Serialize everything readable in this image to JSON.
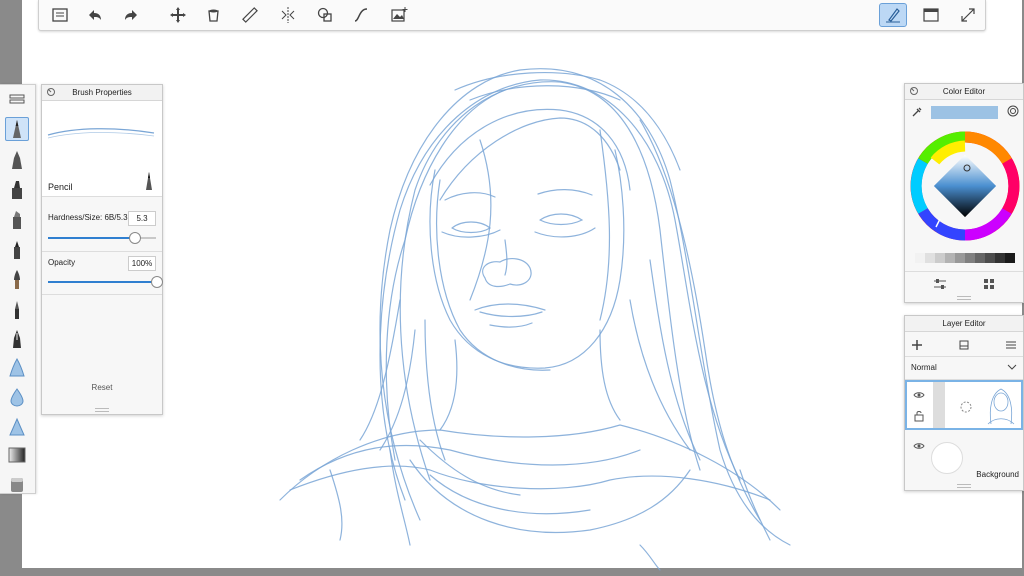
{
  "app": {
    "canvas_bg": "#ffffff",
    "accent": "#2f7fd0",
    "stroke_color": "#7aa6d6"
  },
  "toolbar": {
    "buttons": [
      {
        "name": "gallery-icon"
      },
      {
        "name": "undo-icon"
      },
      {
        "name": "redo-icon"
      },
      {
        "name": "transform-icon"
      },
      {
        "name": "paint-bucket-icon"
      },
      {
        "name": "ruler-icon"
      },
      {
        "name": "symmetry-icon"
      },
      {
        "name": "selection-icon"
      },
      {
        "name": "curve-icon"
      },
      {
        "name": "add-image-icon"
      }
    ],
    "right_buttons": [
      {
        "name": "brush-mode-icon",
        "active": true
      },
      {
        "name": "window-icon"
      },
      {
        "name": "fullscreen-icon"
      }
    ]
  },
  "brush_properties": {
    "title": "Brush Properties",
    "brush_name": "Pencil",
    "hardness_label": "Hardness/Size: 6B/5.3",
    "hardness_value": "5.3",
    "hardness_fraction": 0.8,
    "opacity_label": "Opacity",
    "opacity_value": "100%",
    "opacity_fraction": 1.0,
    "reset_label": "Reset"
  },
  "color_editor": {
    "title": "Color Editor",
    "current_color": "#9cc2e4",
    "grays": [
      "#f2f2f2",
      "#e0e0e0",
      "#cccccc",
      "#b3b3b3",
      "#999999",
      "#808080",
      "#666666",
      "#4d4d4d",
      "#333333",
      "#1a1a1a"
    ]
  },
  "layer_editor": {
    "title": "Layer Editor",
    "blend_mode": "Normal",
    "layers": [
      {
        "name": "",
        "selected": true
      },
      {
        "name": "Background",
        "selected": false
      }
    ]
  }
}
